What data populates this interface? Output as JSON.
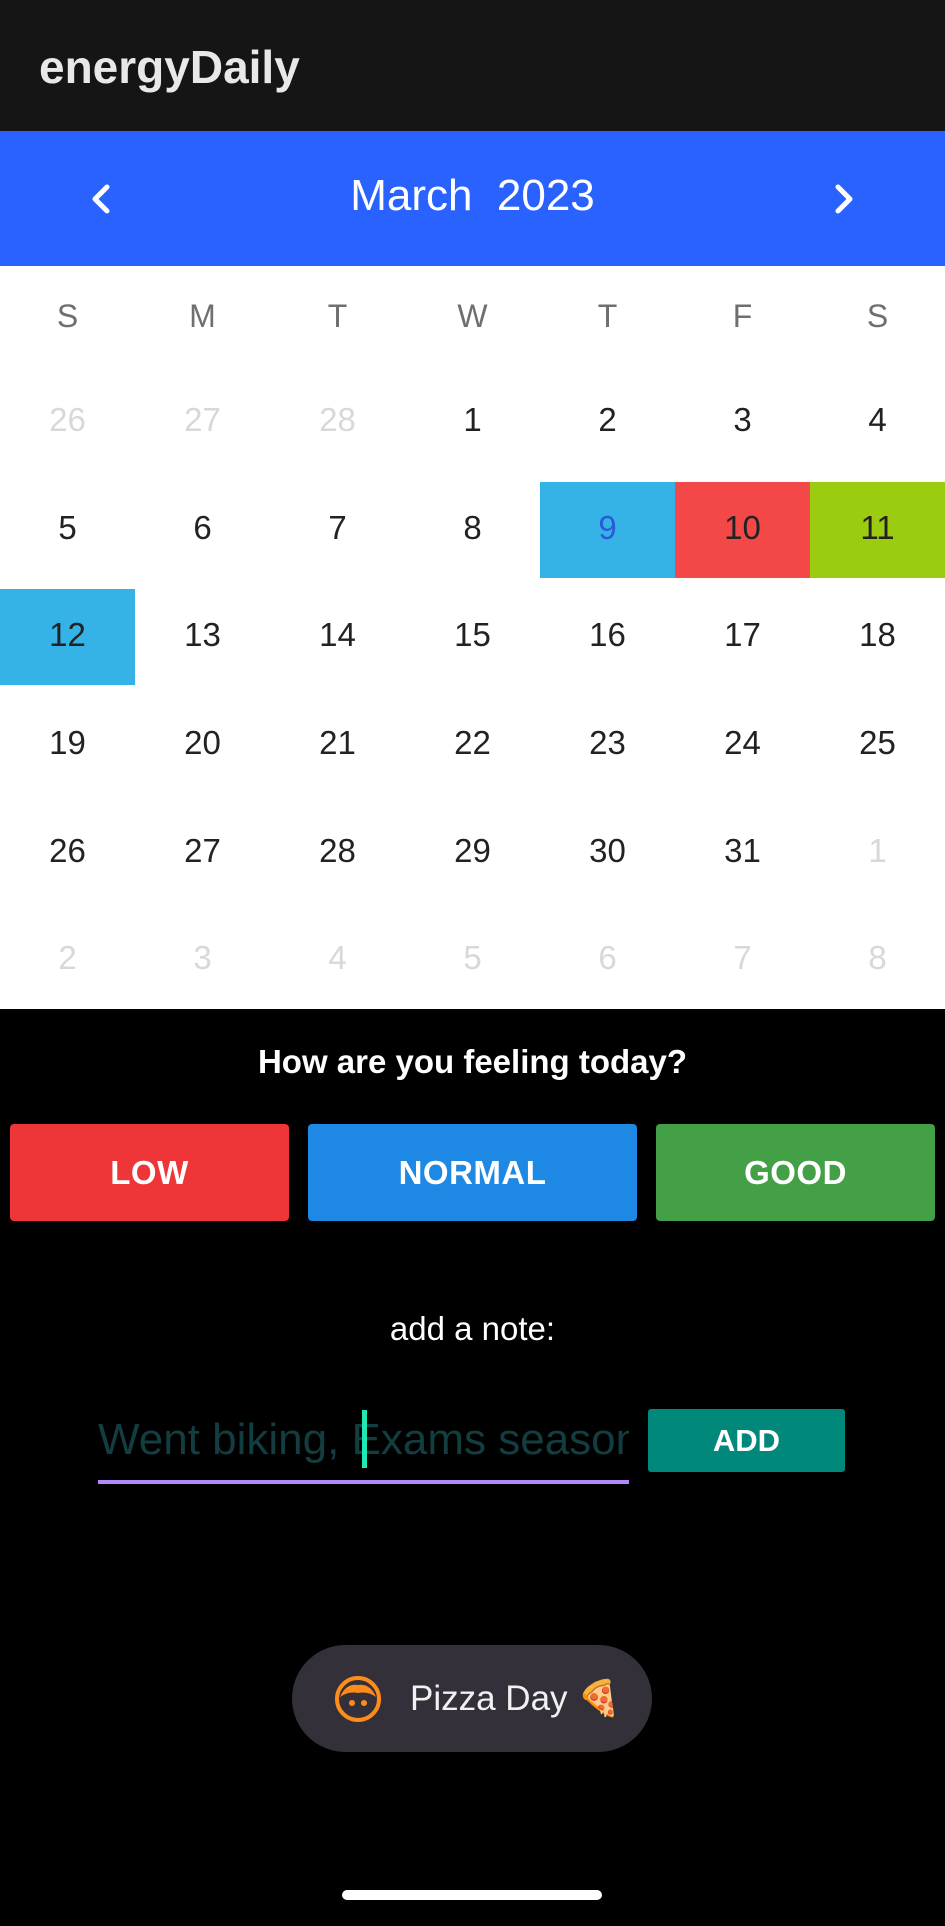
{
  "app": {
    "title": "energyDaily"
  },
  "calendar": {
    "month_year": "March  2023",
    "prev_icon": "chevron-left-icon",
    "next_icon": "chevron-right-icon",
    "weekdays": [
      "S",
      "M",
      "T",
      "W",
      "T",
      "F",
      "S"
    ],
    "days": [
      {
        "label": "26",
        "outside": true,
        "mood": null
      },
      {
        "label": "27",
        "outside": true,
        "mood": null
      },
      {
        "label": "28",
        "outside": true,
        "mood": null
      },
      {
        "label": "1",
        "outside": false,
        "mood": null
      },
      {
        "label": "2",
        "outside": false,
        "mood": null
      },
      {
        "label": "3",
        "outside": false,
        "mood": null
      },
      {
        "label": "4",
        "outside": false,
        "mood": null
      },
      {
        "label": "5",
        "outside": false,
        "mood": null
      },
      {
        "label": "6",
        "outside": false,
        "mood": null
      },
      {
        "label": "7",
        "outside": false,
        "mood": null
      },
      {
        "label": "8",
        "outside": false,
        "mood": null
      },
      {
        "label": "9",
        "outside": false,
        "mood": "normal",
        "selected": true
      },
      {
        "label": "10",
        "outside": false,
        "mood": "low"
      },
      {
        "label": "11",
        "outside": false,
        "mood": "good"
      },
      {
        "label": "12",
        "outside": false,
        "mood": "normal"
      },
      {
        "label": "13",
        "outside": false,
        "mood": null
      },
      {
        "label": "14",
        "outside": false,
        "mood": null
      },
      {
        "label": "15",
        "outside": false,
        "mood": null
      },
      {
        "label": "16",
        "outside": false,
        "mood": null
      },
      {
        "label": "17",
        "outside": false,
        "mood": null
      },
      {
        "label": "18",
        "outside": false,
        "mood": null
      },
      {
        "label": "19",
        "outside": false,
        "mood": null
      },
      {
        "label": "20",
        "outside": false,
        "mood": null
      },
      {
        "label": "21",
        "outside": false,
        "mood": null
      },
      {
        "label": "22",
        "outside": false,
        "mood": null
      },
      {
        "label": "23",
        "outside": false,
        "mood": null
      },
      {
        "label": "24",
        "outside": false,
        "mood": null
      },
      {
        "label": "25",
        "outside": false,
        "mood": null
      },
      {
        "label": "26",
        "outside": false,
        "mood": null
      },
      {
        "label": "27",
        "outside": false,
        "mood": null
      },
      {
        "label": "28",
        "outside": false,
        "mood": null
      },
      {
        "label": "29",
        "outside": false,
        "mood": null
      },
      {
        "label": "30",
        "outside": false,
        "mood": null
      },
      {
        "label": "31",
        "outside": false,
        "mood": null
      },
      {
        "label": "1",
        "outside": true,
        "mood": null
      },
      {
        "label": "2",
        "outside": true,
        "mood": null
      },
      {
        "label": "3",
        "outside": true,
        "mood": null
      },
      {
        "label": "4",
        "outside": true,
        "mood": null
      },
      {
        "label": "5",
        "outside": true,
        "mood": null
      },
      {
        "label": "6",
        "outside": true,
        "mood": null
      },
      {
        "label": "7",
        "outside": true,
        "mood": null
      },
      {
        "label": "8",
        "outside": true,
        "mood": null
      }
    ]
  },
  "mood": {
    "question": "How are you feeling today?",
    "low_label": "LOW",
    "normal_label": "NORMAL",
    "good_label": "GOOD"
  },
  "note": {
    "label": "add a note:",
    "placeholder": "Went biking, Exams season",
    "value": "",
    "add_label": "ADD"
  },
  "toast": {
    "icon": "face-emoji-icon",
    "text": "Pizza Day 🍕"
  },
  "colors": {
    "app_bar": "#151515",
    "calendar_header": "#2962ff",
    "mood_low": "#f44747",
    "mood_normal": "#35b2e6",
    "mood_good": "#9ccc10",
    "btn_low": "#ee3537",
    "btn_normal": "#1e88e5",
    "btn_good": "#43a047",
    "btn_add": "#00897b",
    "input_underline": "#b388ff"
  }
}
